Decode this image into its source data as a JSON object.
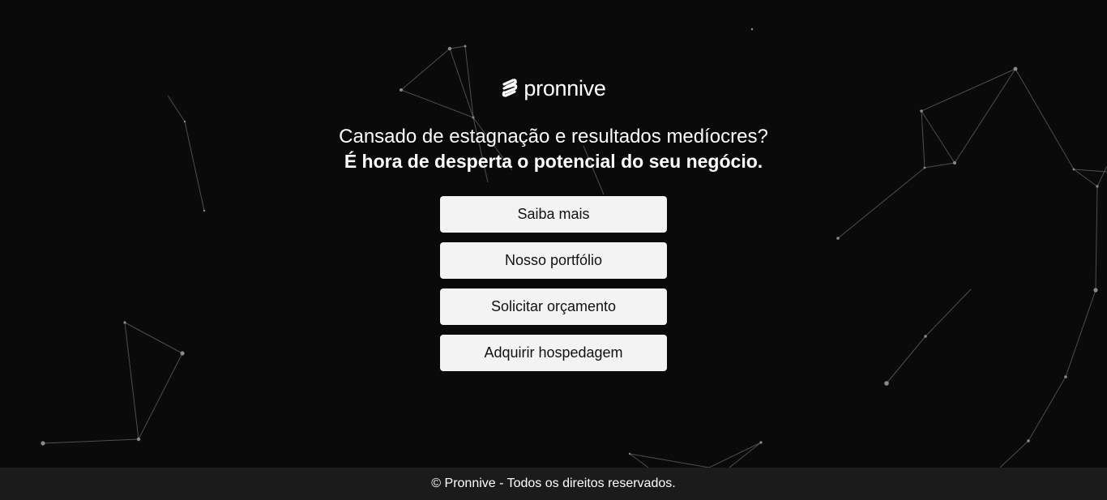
{
  "brand": {
    "name": "pronnive",
    "icon": "pronnive-logo-icon"
  },
  "hero": {
    "headline": "Cansado de estagnação e resultados medíocres?",
    "subheadline": "É hora de desperta o potencial do seu negócio."
  },
  "actions": [
    {
      "label": "Saiba mais"
    },
    {
      "label": "Nosso portfólio"
    },
    {
      "label": "Solicitar orçamento"
    },
    {
      "label": "Adquirir hospedagem"
    }
  ],
  "footer": {
    "text": "© Pronnive - Todos os direitos reservados."
  },
  "colors": {
    "background": "#0a0a0a",
    "button": "#f3f3f3",
    "footer": "#1b1b1b",
    "text": "#ffffff"
  }
}
